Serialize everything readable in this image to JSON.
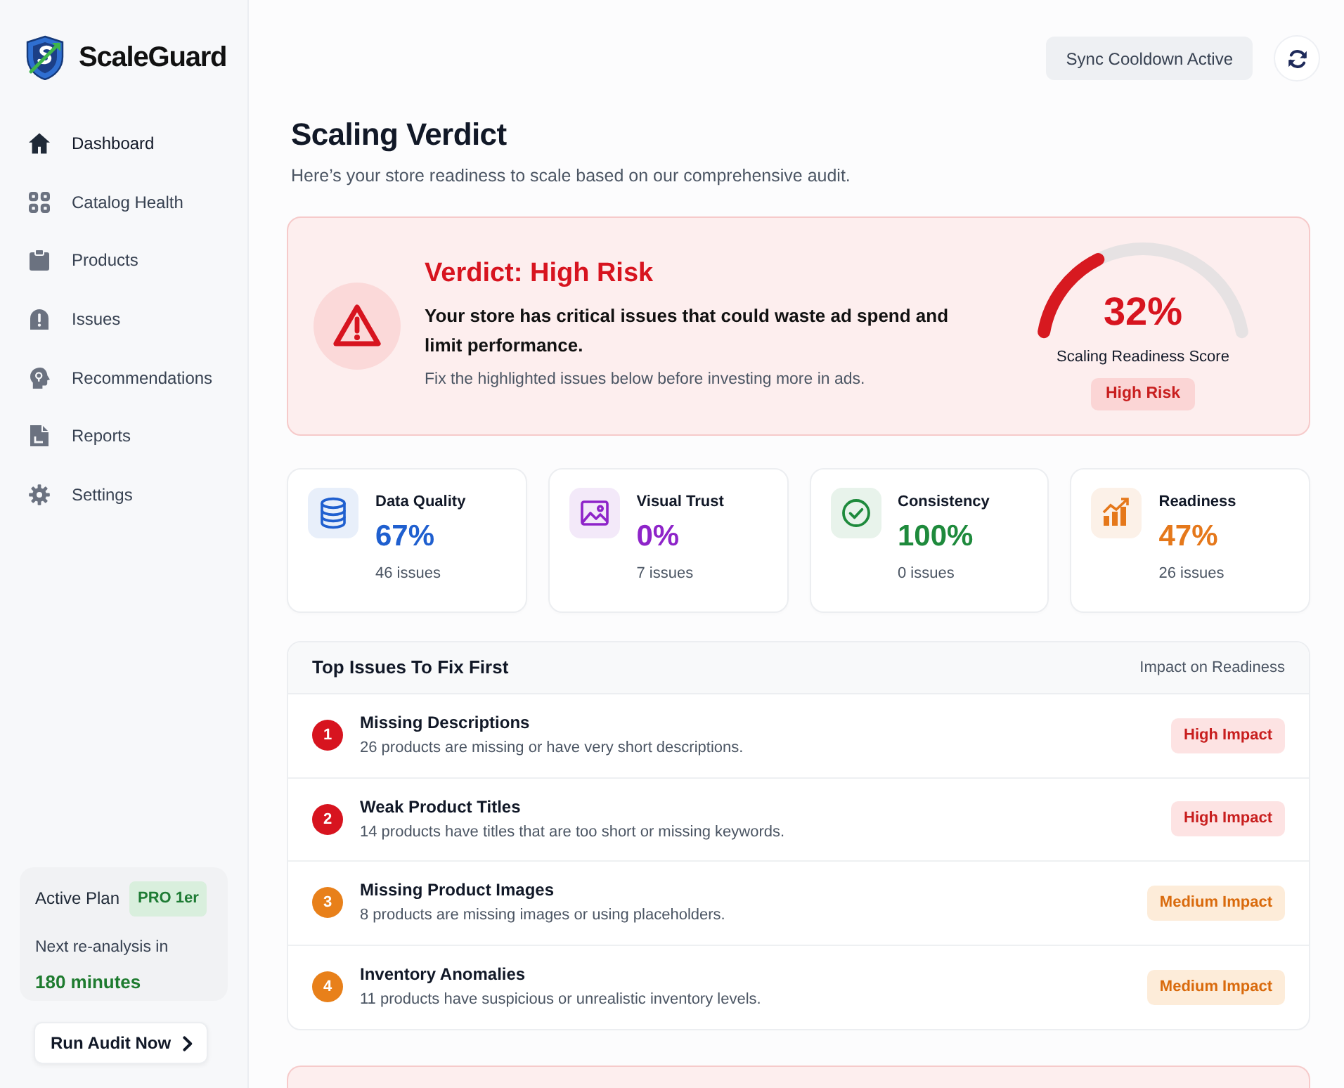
{
  "sidebar": {
    "brand": "ScaleGuard",
    "items": [
      {
        "label": "Dashboard",
        "kind": "home",
        "selected": true
      },
      {
        "label": "Catalog Health",
        "kind": "grid",
        "selected": false
      },
      {
        "label": "Products",
        "kind": "clipboard",
        "selected": false
      },
      {
        "label": "Issues",
        "kind": "alert",
        "selected": false
      },
      {
        "label": "Recommendations",
        "kind": "head",
        "selected": false
      },
      {
        "label": "Reports",
        "kind": "document",
        "selected": false
      },
      {
        "label": "Settings",
        "kind": "gear",
        "selected": false
      }
    ],
    "plan": {
      "label": "Active Plan",
      "badge": "PRO 1er",
      "next_label": "Next re-analysis in",
      "next_value": "180 minutes"
    },
    "run_button": "Run Audit Now"
  },
  "toolbar": {
    "sync_button": {
      "label": "Sync Cooldown Active",
      "disabled": true
    }
  },
  "header": {
    "title": "Scaling Verdict",
    "subtitle": "Here’s your store readiness to scale based on our comprehensive audit."
  },
  "verdict": {
    "title": "Verdict: High Risk",
    "message": "Your store has critical issues that could waste ad spend and limit performance.",
    "hint": "Fix the highlighted issues below before investing more in ads.",
    "score": {
      "value": "32%",
      "level": 0.32,
      "label": "Scaling Readiness Score",
      "badge": "High Risk"
    }
  },
  "metrics": [
    {
      "kind": "database",
      "title": "Data Quality",
      "value": "67%",
      "issues": "46 issues",
      "color": "#1f5fcf"
    },
    {
      "kind": "image",
      "title": "Visual Trust",
      "value": "0%",
      "issues": "7 issues",
      "color": "#8e24c9"
    },
    {
      "kind": "check",
      "title": "Consistency",
      "value": "100%",
      "issues": "0 issues",
      "color": "#1e8a3c"
    },
    {
      "kind": "chart",
      "title": "Readiness",
      "value": "47%",
      "issues": "26 issues",
      "color": "#e5781b"
    }
  ],
  "issues": {
    "title": "Top Issues To Fix First",
    "column_label": "Impact on Readiness",
    "rows": [
      {
        "number": "1",
        "title": "Missing Descriptions",
        "description": "26 products are missing or have very short descriptions.",
        "impact": "High Impact",
        "kind": "high"
      },
      {
        "number": "2",
        "title": "Weak Product Titles",
        "description": "14 products have titles that are too short or missing keywords.",
        "impact": "High Impact",
        "kind": "high"
      },
      {
        "number": "3",
        "title": "Missing Product Images",
        "description": "8 products are missing images or using placeholders.",
        "impact": "Medium Impact",
        "kind": "medium"
      },
      {
        "number": "4",
        "title": "Inventory Anomalies",
        "description": "11 products have suspicious or unrealistic inventory levels.",
        "impact": "Medium Impact",
        "kind": "medium"
      }
    ]
  }
}
